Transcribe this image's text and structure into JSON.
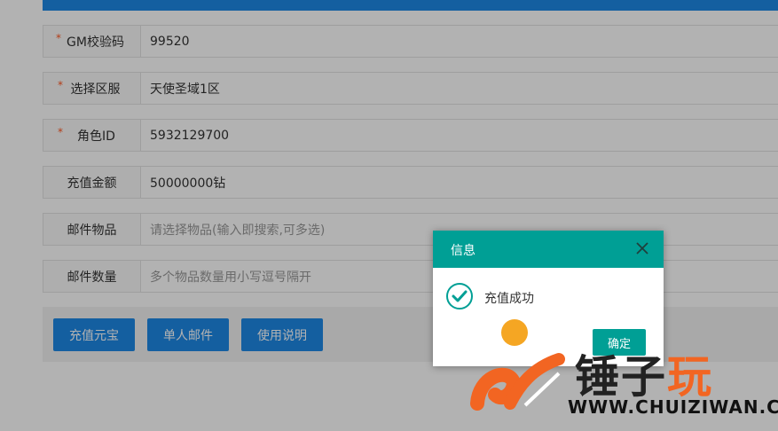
{
  "form": {
    "rows": [
      {
        "label": "GM校验码",
        "required": "*",
        "value": "99520"
      },
      {
        "label": "选择区服",
        "required": "*",
        "value": "天使圣域1区"
      },
      {
        "label": "角色ID",
        "required": "*",
        "value": "5932129700"
      },
      {
        "label": "充值金额",
        "value": "50000000钻"
      },
      {
        "label": "邮件物品",
        "placeholder": "请选择物品(输入即搜索,可多选)"
      },
      {
        "label": "邮件数量",
        "placeholder": "多个物品数量用小写逗号隔开"
      }
    ]
  },
  "buttons": {
    "recharge": "充值元宝",
    "single_mail": "单人邮件",
    "instructions": "使用说明"
  },
  "dialog": {
    "title": "信息",
    "message": "充值成功",
    "ok": "确定"
  },
  "watermark": {
    "text_part1": "锤",
    "text_part2": "子",
    "text_part3": "玩",
    "url": "WWW.CHUIZIWAN.COM"
  },
  "colors": {
    "primary": "#1e88e5",
    "dialog_accent": "#009f95",
    "required": "#ff5722",
    "watermark_orange": "#f26522"
  },
  "icons": [
    "close-icon",
    "success-check-icon"
  ]
}
